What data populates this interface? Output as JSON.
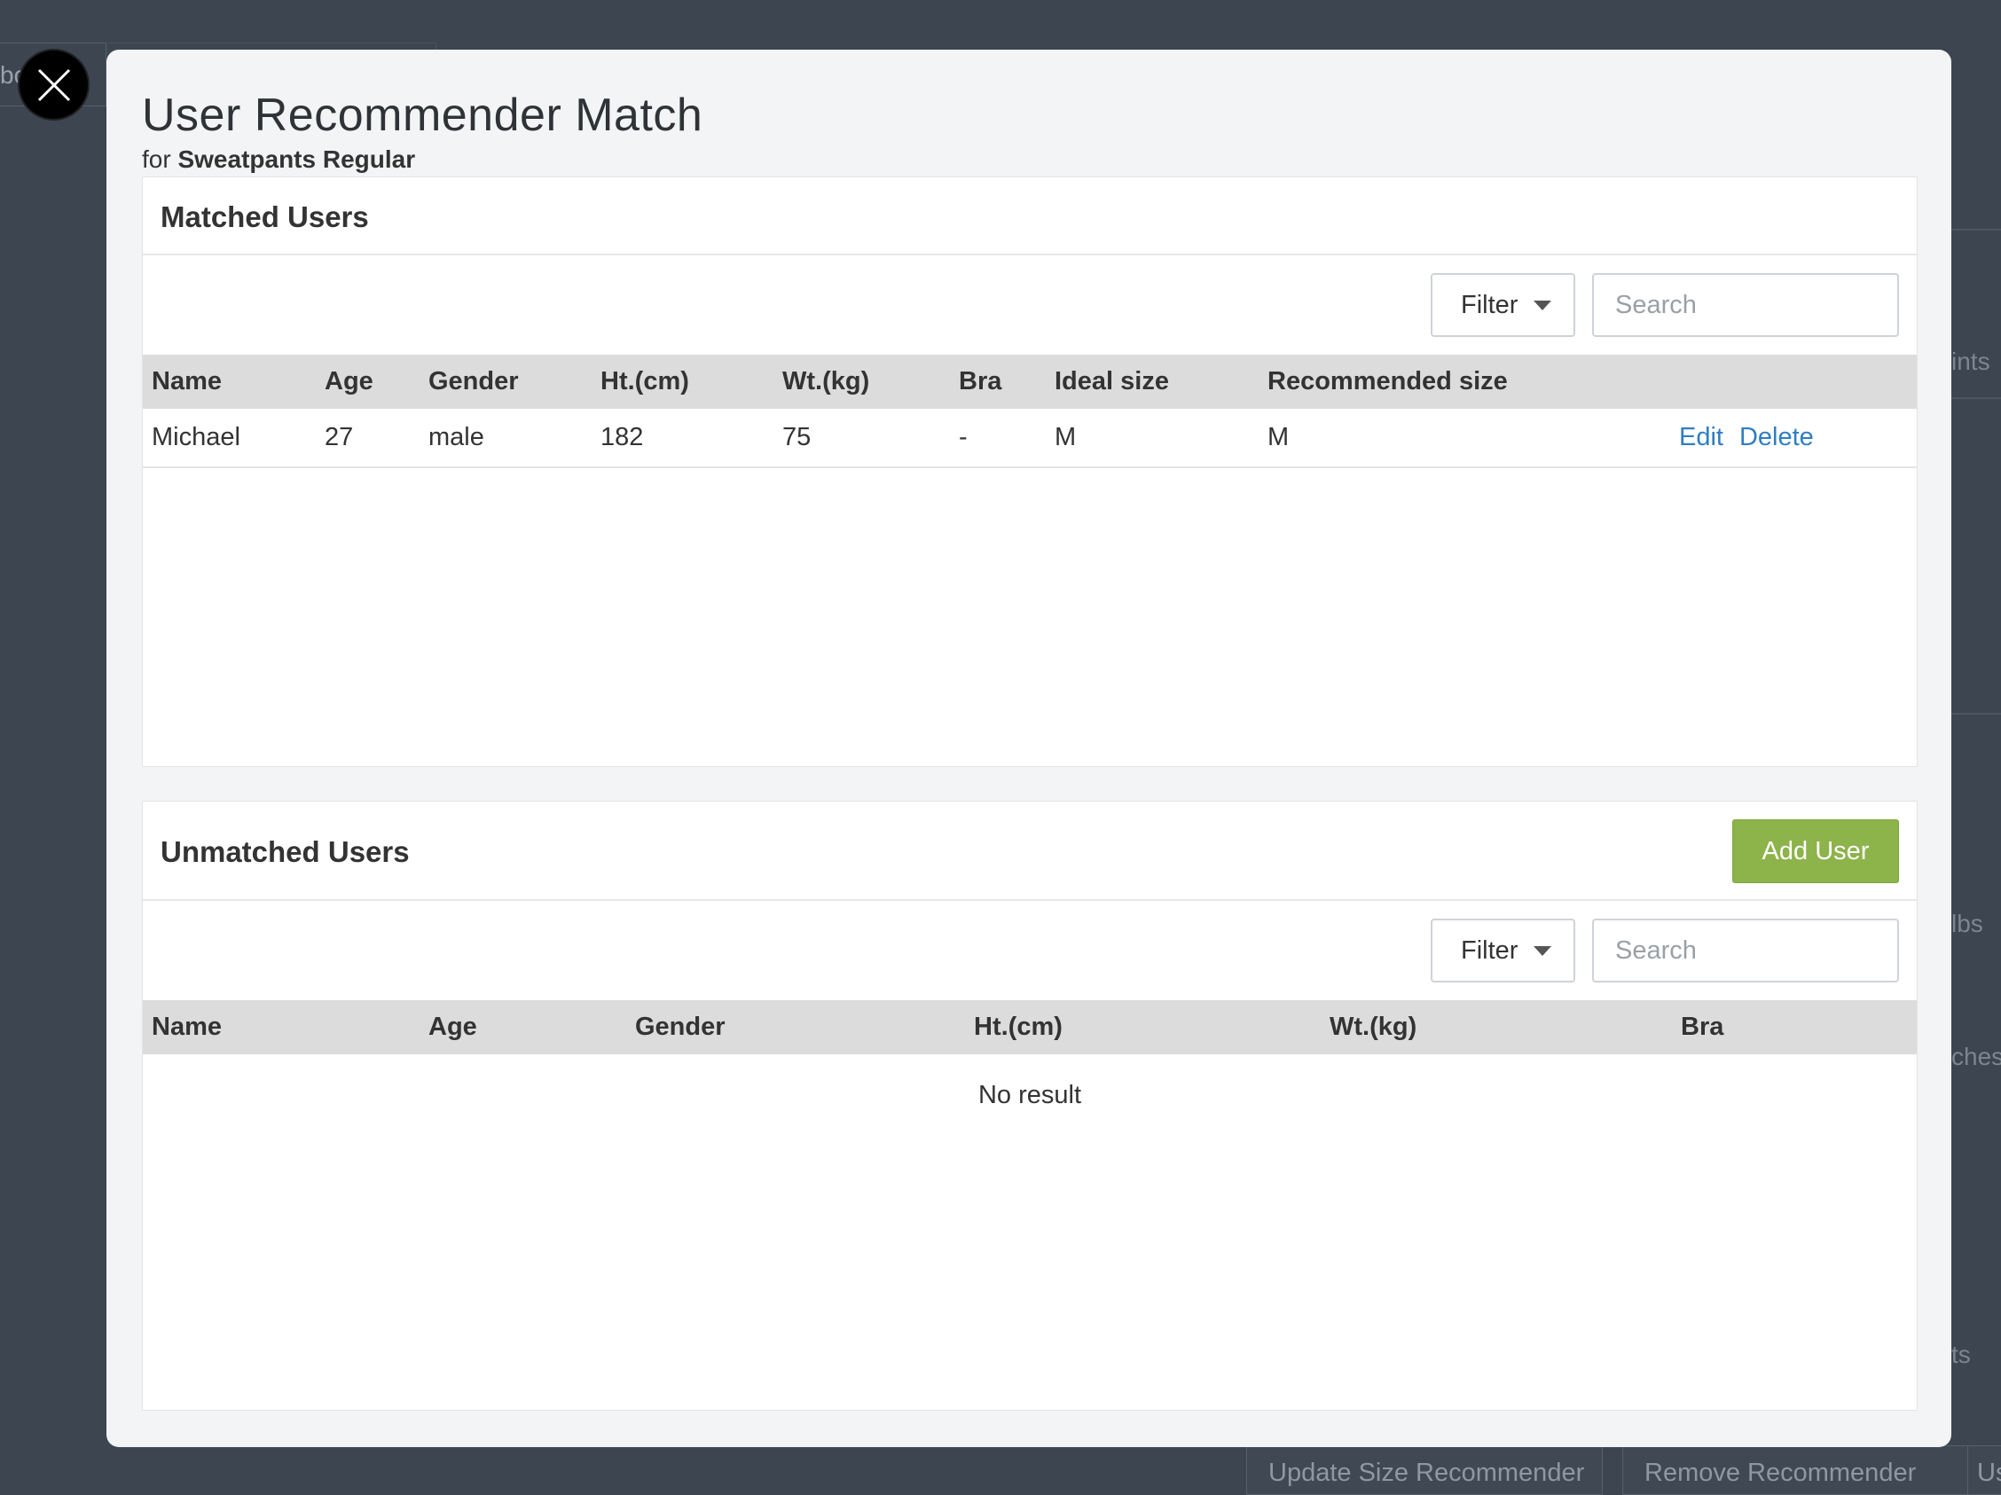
{
  "background": {
    "tab_fragment": "bo",
    "side_fragments": [
      "ints",
      "lbs",
      "ches",
      "ts"
    ],
    "bottom_buttons": [
      "Update Size Recommender",
      "Remove Recommender",
      "Us"
    ]
  },
  "modal": {
    "title": "User Recommender Match",
    "subtitle_prefix": "for",
    "product_name": "Sweatpants Regular",
    "close_icon": "close-icon"
  },
  "matched": {
    "title": "Matched Users",
    "filter_label": "Filter",
    "search_placeholder": "Search",
    "columns": [
      "Name",
      "Age",
      "Gender",
      "Ht.(cm)",
      "Wt.(kg)",
      "Bra",
      "Ideal size",
      "Recommended size",
      ""
    ],
    "rows": [
      {
        "name": "Michael",
        "age": "27",
        "gender": "male",
        "height": "182",
        "weight": "75",
        "bra": "-",
        "ideal": "M",
        "recommended": "M",
        "edit": "Edit",
        "delete": "Delete"
      }
    ]
  },
  "unmatched": {
    "title": "Unmatched Users",
    "add_user_label": "Add User",
    "filter_label": "Filter",
    "search_placeholder": "Search",
    "columns": [
      "Name",
      "Age",
      "Gender",
      "Ht.(cm)",
      "Wt.(kg)",
      "Bra"
    ],
    "empty_text": "No result"
  },
  "colors": {
    "link": "#2f7ec2",
    "add_button": "#8db34b",
    "overlay": "#3c4550"
  }
}
